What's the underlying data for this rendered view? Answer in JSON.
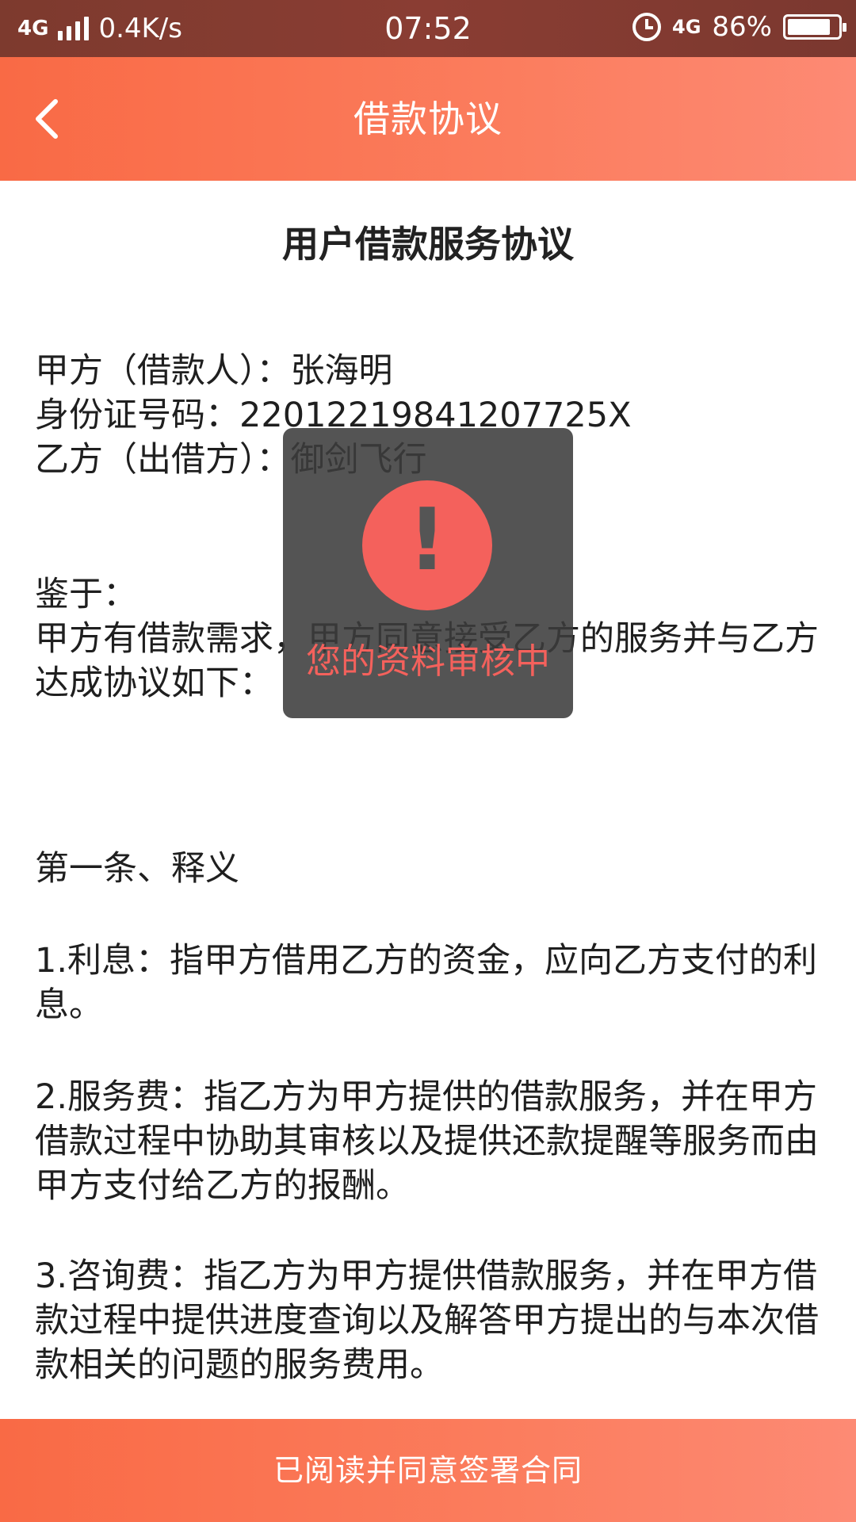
{
  "status_bar": {
    "network_type": "4G",
    "speed": "0.4K/s",
    "time": "07:52",
    "network_type_right": "4G",
    "battery_text": "86%",
    "battery_level": 0.86
  },
  "header": {
    "title": "借款协议",
    "back_icon": "chevron-left-icon"
  },
  "document": {
    "title": "用户借款服务协议",
    "party_a": "甲方（借款人）：张海明",
    "id_number": "身份证号码：22012219841207725X",
    "party_b": "乙方（出借方）：御剑飞行",
    "whereas_label": "鉴于：",
    "whereas_text": "甲方有借款需求，甲方同意接受乙方的服务并与乙方达成协议如下：",
    "article1_title": "第一条、释义",
    "clause1": "1.利息：指甲方借用乙方的资金，应向乙方支付的利息。",
    "clause2": "2.服务费：指乙方为甲方提供的借款服务，并在甲方借款过程中协助其审核以及提供还款提醒等服务而由甲方支付给乙方的报酬。",
    "clause3": "3.咨询费：指乙方为甲方提供借款服务，并在甲方借款过程中提供进度查询以及解答甲方提出的与本次借款相关的问题的服务费用。"
  },
  "toast": {
    "icon": "exclamation-icon",
    "message": "您的资料审核中",
    "accent_color": "#f4615c"
  },
  "footer": {
    "agree_label": "已阅读并同意签署合同"
  },
  "colors": {
    "brand": "#f96a45",
    "status_bar": "#7d3a2e"
  }
}
